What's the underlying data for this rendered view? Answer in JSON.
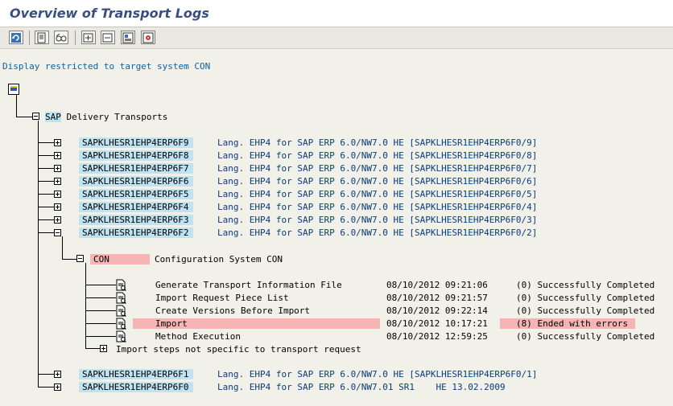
{
  "window": {
    "title": "Overview of Transport Logs"
  },
  "toolbar": {
    "buttons": [
      {
        "icon": "refresh-icon"
      },
      {
        "icon": "display-icon"
      },
      {
        "icon": "glasses-icon"
      },
      {
        "icon": "expand-icon"
      },
      {
        "icon": "collapse-icon"
      },
      {
        "icon": "save-list-icon"
      },
      {
        "icon": "settings-icon"
      }
    ]
  },
  "restriction_text": "Display restricted to target system CON",
  "tree": {
    "root_label": "SAP Delivery Transports",
    "root_prefix": "SAP",
    "root_rest": " Delivery Transports",
    "transports_top": [
      {
        "id": "SAPKLHESR1EHP4ERP6F9",
        "desc": "Lang. EHP4 for SAP ERP 6.0/NW7.0 HE [SAPKLHESR1EHP4ERP6F0/9]"
      },
      {
        "id": "SAPKLHESR1EHP4ERP6F8",
        "desc": "Lang. EHP4 for SAP ERP 6.0/NW7.0 HE [SAPKLHESR1EHP4ERP6F0/8]"
      },
      {
        "id": "SAPKLHESR1EHP4ERP6F7",
        "desc": "Lang. EHP4 for SAP ERP 6.0/NW7.0 HE [SAPKLHESR1EHP4ERP6F0/7]"
      },
      {
        "id": "SAPKLHESR1EHP4ERP6F6",
        "desc": "Lang. EHP4 for SAP ERP 6.0/NW7.0 HE [SAPKLHESR1EHP4ERP6F0/6]"
      },
      {
        "id": "SAPKLHESR1EHP4ERP6F5",
        "desc": "Lang. EHP4 for SAP ERP 6.0/NW7.0 HE [SAPKLHESR1EHP4ERP6F0/5]"
      },
      {
        "id": "SAPKLHESR1EHP4ERP6F4",
        "desc": "Lang. EHP4 for SAP ERP 6.0/NW7.0 HE [SAPKLHESR1EHP4ERP6F0/4]"
      },
      {
        "id": "SAPKLHESR1EHP4ERP6F3",
        "desc": "Lang. EHP4 for SAP ERP 6.0/NW7.0 HE [SAPKLHESR1EHP4ERP6F0/3]"
      },
      {
        "id": "SAPKLHESR1EHP4ERP6F2",
        "desc": "Lang. EHP4 for SAP ERP 6.0/NW7.0 HE [SAPKLHESR1EHP4ERP6F0/2]"
      }
    ],
    "system_node": {
      "id": "CON",
      "desc": "Configuration System CON"
    },
    "steps": [
      {
        "name": "Generate Transport Information File",
        "date": "08/10/2012 09:21:06",
        "status": "(0) Successfully Completed",
        "error": false
      },
      {
        "name": "Import Request Piece List",
        "date": "08/10/2012 09:21:57",
        "status": "(0) Successfully Completed",
        "error": false
      },
      {
        "name": "Create Versions Before Import",
        "date": "08/10/2012 09:22:14",
        "status": "(0) Successfully Completed",
        "error": false
      },
      {
        "name": "Import",
        "date": "08/10/2012 10:17:21",
        "status": "(8) Ended with errors",
        "error": true
      },
      {
        "name": "Method Execution",
        "date": "08/10/2012 12:59:25",
        "status": "(0) Successfully Completed",
        "error": false
      }
    ],
    "nonspecific_label": "Import steps not specific to transport request",
    "transports_bottom": [
      {
        "id": "SAPKLHESR1EHP4ERP6F1",
        "desc": "Lang. EHP4 for SAP ERP 6.0/NW7.0 HE [SAPKLHESR1EHP4ERP6F0/1]"
      },
      {
        "id": "SAPKLHESR1EHP4ERP6F0",
        "desc": "Lang. EHP4 for SAP ERP 6.0/NW7.01 SR1    HE 13.02.2009"
      }
    ]
  },
  "colors": {
    "title": "#3a4f7f",
    "highlight_blue": "#bfe3f1",
    "error_red": "#f6b5b5",
    "desc_blue": "#0a3c78"
  }
}
